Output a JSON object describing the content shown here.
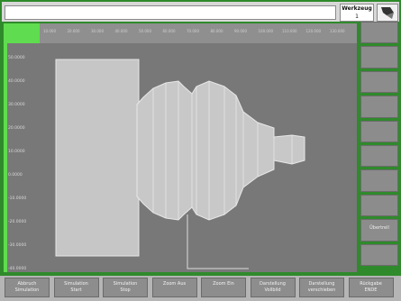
{
  "header": {
    "werkzeug_label": "Werkzeug",
    "werkzeug_value": "1",
    "tool_icon": "cutting-tool-icon"
  },
  "scale": {
    "top_ticks": [
      "10.000",
      "20.000",
      "30.000",
      "40.000",
      "50.000",
      "60.000",
      "70.000",
      "80.000",
      "90.000",
      "100.000",
      "110.000",
      "120.000",
      "130.000"
    ],
    "left_ticks": [
      "50.0000",
      "40.0000",
      "30.0000",
      "20.0000",
      "10.0000",
      "0.0000",
      "-10.0000",
      "-20.0000",
      "-30.0000",
      "-40.0000"
    ]
  },
  "side_softkeys": {
    "labels": [
      "",
      "",
      "",
      "",
      "",
      "",
      "",
      "",
      "Übertrell",
      ""
    ]
  },
  "bottom_softkeys": {
    "labels": [
      [
        "Abbruch",
        "Simulation"
      ],
      [
        "Simulation",
        "Start"
      ],
      [
        "Simulation",
        "Stop"
      ],
      [
        "Zoom Aus"
      ],
      [
        "Zoom Ein"
      ],
      [
        "Darstellung",
        "Vollbild"
      ],
      [
        "Darstellung",
        "verschieben"
      ],
      [
        "Rückgabe",
        "ENDE"
      ]
    ]
  },
  "colors": {
    "frame_green": "#2f8a2b",
    "accent_green": "#5fdc4f",
    "viewport_gray": "#787878",
    "part_gray": "#c8c8c8"
  }
}
